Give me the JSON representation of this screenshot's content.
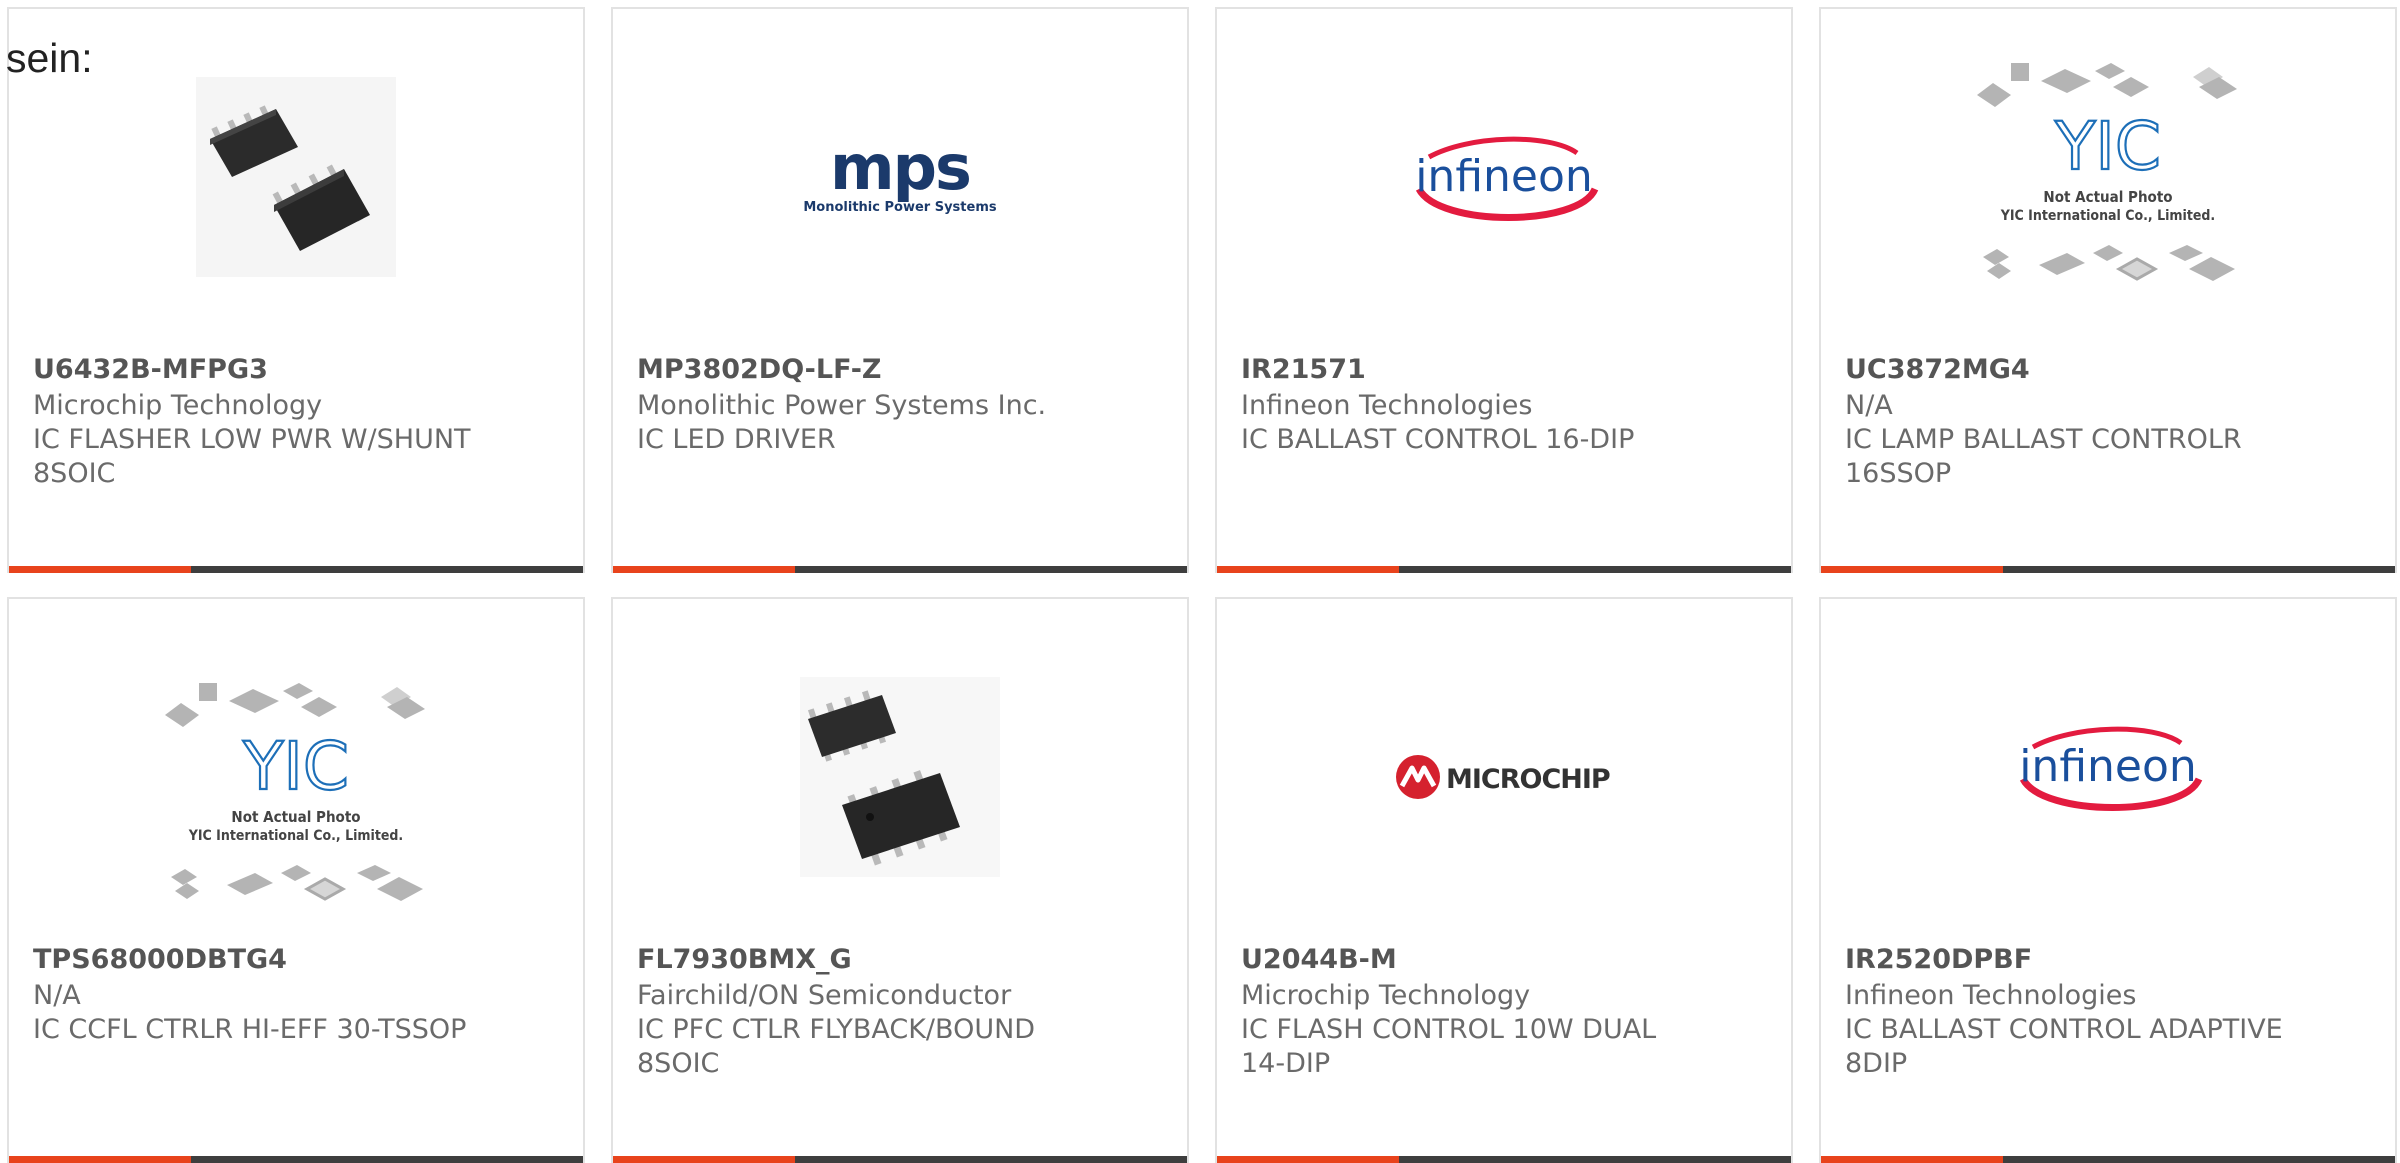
{
  "lead_text": "sein:",
  "colors": {
    "accent": "#e8431c",
    "bar_dark": "#3e3e3e",
    "border": "#e2e2e2",
    "text": "#6a6a6a",
    "part_number": "#555555"
  },
  "products": [
    {
      "part_number": "U6432B-MFPG3",
      "manufacturer": "Microchip Technology",
      "description": "IC FLASHER LOW PWR W/SHUNT 8SOIC",
      "image": "soic8-chips-photo"
    },
    {
      "part_number": "MP3802DQ-LF-Z",
      "manufacturer": "Monolithic Power Systems Inc.",
      "description": "IC LED DRIVER",
      "image": "mps-logo",
      "logo": {
        "wordmark": "mps",
        "tagline": "Monolithic Power Systems"
      }
    },
    {
      "part_number": "IR21571",
      "manufacturer": "Infineon Technologies",
      "description": "IC BALLAST CONTROL 16-DIP",
      "image": "infineon-logo",
      "logo": {
        "wordmark": "infineon"
      }
    },
    {
      "part_number": "UC3872MG4",
      "manufacturer": "N/A",
      "description": "IC LAMP BALLAST CONTROLR 16SSOP",
      "image": "yic-not-actual-photo",
      "placeholder": {
        "brand": "YIC",
        "line1": "Not Actual Photo",
        "line2": "YIC International Co., Limited."
      }
    },
    {
      "part_number": "TPS68000DBTG4",
      "manufacturer": "N/A",
      "description": "IC CCFL CTRLR HI-EFF 30-TSSOP",
      "image": "yic-not-actual-photo",
      "placeholder": {
        "brand": "YIC",
        "line1": "Not Actual Photo",
        "line2": "YIC International Co., Limited."
      }
    },
    {
      "part_number": "FL7930BMX_G",
      "manufacturer": "Fairchild/ON Semiconductor",
      "description": "IC PFC CTLR FLYBACK/BOUND 8SOIC",
      "image": "soic8-chips-photo"
    },
    {
      "part_number": "U2044B-M",
      "manufacturer": "Microchip Technology",
      "description": "IC FLASH CONTROL 10W DUAL 14-DIP",
      "image": "microchip-logo",
      "logo": {
        "wordmark": "MICROCHIP"
      }
    },
    {
      "part_number": "IR2520DPBF",
      "manufacturer": "Infineon Technologies",
      "description": "IC BALLAST CONTROL ADAPTIVE 8DIP",
      "image": "infineon-logo",
      "logo": {
        "wordmark": "infineon"
      }
    }
  ]
}
